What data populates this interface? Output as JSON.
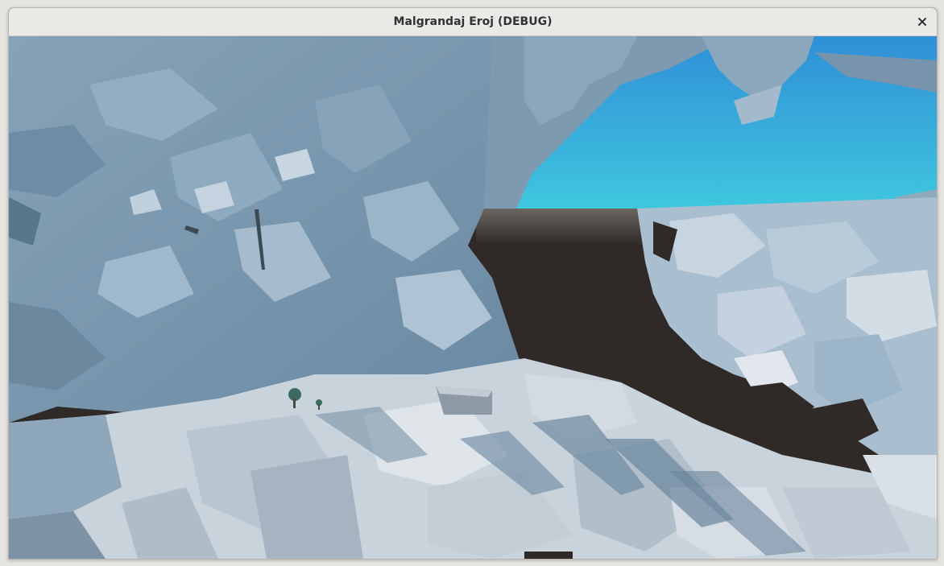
{
  "window": {
    "title": "Malgrandaj Eroj (DEBUG)",
    "close_icon": "close-icon"
  },
  "scene": {
    "description_icon": "game-3d-scene",
    "colors": {
      "sky_top": "#2f8fd6",
      "sky_bottom": "#3fc7df",
      "void": "#2f2a27",
      "ice_dark": "#6f8ea6",
      "ice_mid": "#8ba7be",
      "ice_light": "#b7c9d8",
      "snow": "#d5dde4",
      "tree": "#3d6b62"
    }
  }
}
